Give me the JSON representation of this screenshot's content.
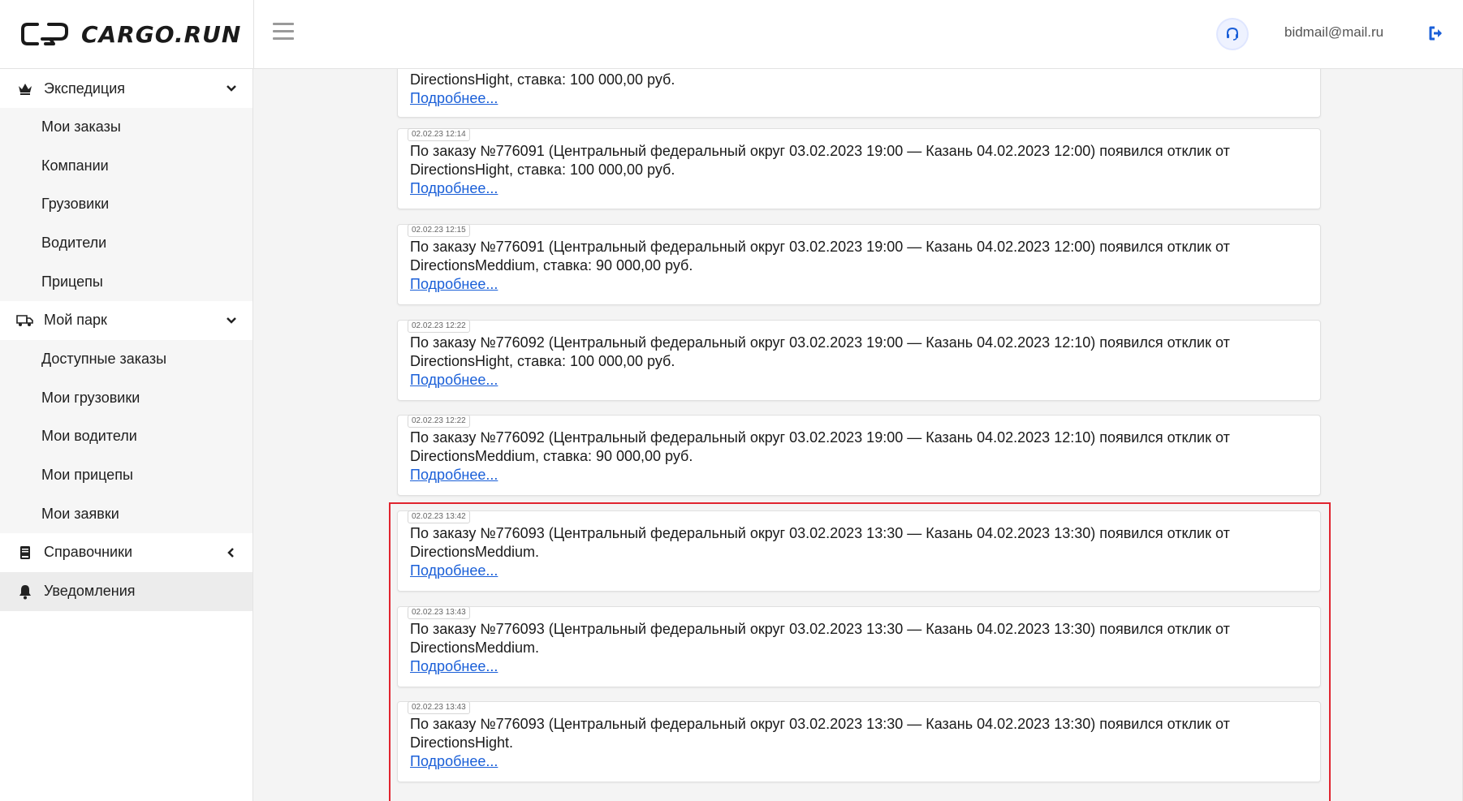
{
  "header": {
    "logo_text": "CARGO.RUN",
    "user_email": "bidmail@mail.ru",
    "accent_color": "#1a5fd8"
  },
  "sidebar": {
    "groups": [
      {
        "label": "Экспедиция",
        "icon": "crown-icon",
        "expanded": true,
        "items": [
          "Мои заказы",
          "Компании",
          "Грузовики",
          "Водители",
          "Прицепы"
        ]
      },
      {
        "label": "Мой парк",
        "icon": "truck-icon",
        "expanded": true,
        "items": [
          "Доступные заказы",
          "Мои грузовики",
          "Мои водители",
          "Мои прицепы",
          "Мои заявки"
        ]
      },
      {
        "label": "Справочники",
        "icon": "book-icon",
        "expanded": false,
        "items": []
      },
      {
        "label": "Уведомления",
        "icon": "bell-icon",
        "active": true,
        "items": []
      }
    ]
  },
  "notifications": {
    "more_label": "Подробнее...",
    "items": [
      {
        "timestamp": "",
        "line1": "",
        "line2": "DirectionsHight, ставка: 100 000,00 руб."
      },
      {
        "timestamp": "02.02.23 12:14",
        "line1": "По заказу №776091 (Центральный федеральный округ 03.02.2023 19:00 — Казань 04.02.2023 12:00) появился отклик от",
        "line2": "DirectionsHight, ставка: 100 000,00 руб."
      },
      {
        "timestamp": "02.02.23 12:15",
        "line1": "По заказу №776091 (Центральный федеральный округ 03.02.2023 19:00 — Казань 04.02.2023 12:00) появился отклик от",
        "line2": "DirectionsMeddium, ставка: 90 000,00 руб."
      },
      {
        "timestamp": "02.02.23 12:22",
        "line1": "По заказу №776092 (Центральный федеральный округ 03.02.2023 19:00 — Казань 04.02.2023 12:10) появился отклик от",
        "line2": "DirectionsHight, ставка: 100 000,00 руб."
      },
      {
        "timestamp": "02.02.23 12:22",
        "line1": "По заказу №776092 (Центральный федеральный округ 03.02.2023 19:00 — Казань 04.02.2023 12:10) появился отклик от",
        "line2": "DirectionsMeddium, ставка: 90 000,00 руб."
      },
      {
        "timestamp": "02.02.23 13:42",
        "line1": "По заказу №776093 (Центральный федеральный округ 03.02.2023 13:30 — Казань 04.02.2023 13:30) появился отклик от",
        "line2": "DirectionsMeddium."
      },
      {
        "timestamp": "02.02.23 13:43",
        "line1": "По заказу №776093 (Центральный федеральный округ 03.02.2023 13:30 — Казань 04.02.2023 13:30) появился отклик от",
        "line2": "DirectionsMeddium."
      },
      {
        "timestamp": "02.02.23 13:43",
        "line1": "По заказу №776093 (Центральный федеральный округ 03.02.2023 13:30 — Казань 04.02.2023 13:30) появился отклик от",
        "line2": "DirectionsHight."
      }
    ]
  }
}
